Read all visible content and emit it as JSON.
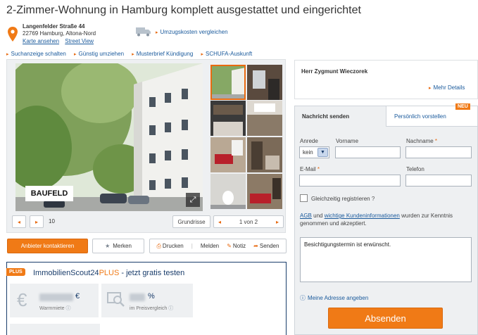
{
  "listing": {
    "title": "2-Zimmer-Wohnung in Hamburg komplett ausgestattet und eingerichtet",
    "street": "Langenfelder Straße 44",
    "city": "22769 Hamburg, Altona-Nord",
    "map_link": "Karte ansehen",
    "street_view_link": "Street View",
    "moving_costs_link": "Umzugskosten vergleichen"
  },
  "sublinks": [
    "Suchanzeige schalten",
    "Günstig umziehen",
    "Musterbrief Kündigung",
    "SCHUFA-Auskunft"
  ],
  "gallery": {
    "watermark": "BAUFELD",
    "image_count": "10",
    "layout_button": "Grundrisse",
    "pager": "1 von 2",
    "selected_thumb": 1
  },
  "actions": {
    "contact": "Anbieter kontaktieren",
    "save": "Merken",
    "print": "Drucken",
    "report": "Melden",
    "note": "Notiz",
    "send": "Senden"
  },
  "plus": {
    "badge": "PLUS",
    "title_pre": "ImmobilienScout24",
    "title_plus": "PLUS",
    "title_post": " - jetzt gratis testen",
    "stat1_unit": "€",
    "stat1_label": "Warmmiete",
    "stat2_unit": "%",
    "stat2_label": "im Preisvergleich"
  },
  "contact": {
    "agent_name": "Herr Zygmunt Wieczorek",
    "details_link": "Mehr Details"
  },
  "form": {
    "tab_message": "Nachricht senden",
    "tab_introduce": "Persönlich vorstellen",
    "new_badge": "NEU",
    "salutation_label": "Anrede",
    "salutation_value": "kein",
    "firstname_label": "Vorname",
    "lastname_label": "Nachname",
    "email_label": "E-Mail",
    "phone_label": "Telefon",
    "register_label": "Gleichzeitig registrieren",
    "legal_agb": "AGB",
    "legal_and": " und ",
    "legal_info": "wichtige Kundeninformationen",
    "legal_rest": " wurden zur Kenntnis genommen und akzeptiert.",
    "message": "Besichtigungstermin ist erwünscht.",
    "address_link": "Meine Adresse angeben",
    "submit": "Absenden"
  },
  "colors": {
    "accent": "#f07a16",
    "link": "#1a5a9c",
    "panel": "#eef0f2",
    "navy": "#1a3d6b"
  }
}
